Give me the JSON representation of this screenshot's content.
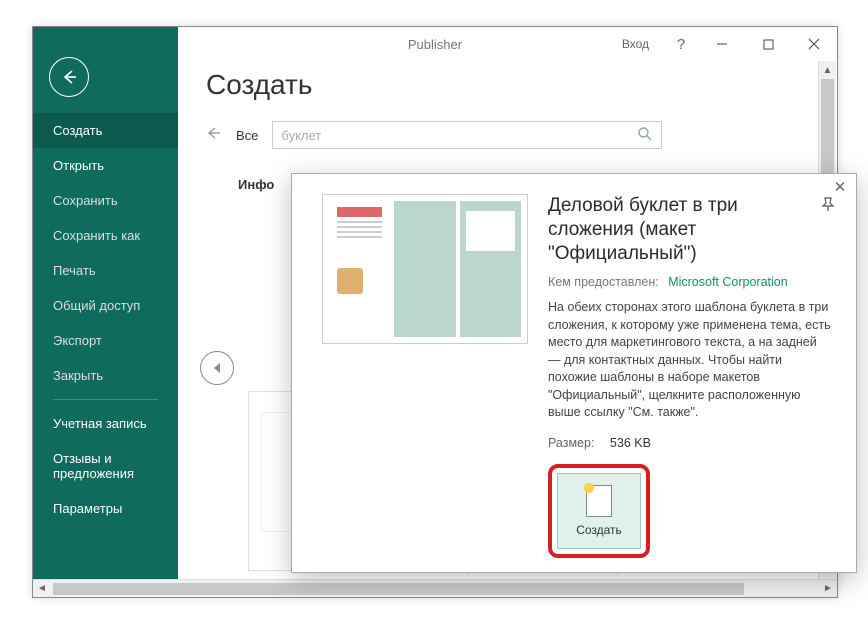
{
  "window": {
    "title": "Publisher",
    "signin": "Вход",
    "help": "?"
  },
  "sidebar": {
    "items": [
      {
        "label": "Создать",
        "active": true
      },
      {
        "label": "Открыть",
        "strong": true
      },
      {
        "label": "Сохранить"
      },
      {
        "label": "Сохранить как"
      },
      {
        "label": "Печать"
      },
      {
        "label": "Общий доступ"
      },
      {
        "label": "Экспорт"
      },
      {
        "label": "Закрыть"
      }
    ],
    "footer": [
      {
        "label": "Учетная запись"
      },
      {
        "label": "Отзывы и предложения"
      },
      {
        "label": "Параметры"
      }
    ]
  },
  "main": {
    "heading": "Создать",
    "all": "Все",
    "search_value": "буклет",
    "category": "Инфо"
  },
  "modal": {
    "title": "Деловой буклет в три сложения (макет \"Официальный\")",
    "provided_label": "Кем предоставлен:",
    "provided_by": "Microsoft Corporation",
    "description": "На обеих сторонах этого шаблона буклета в три сложения, к которому уже применена тема, есть место для маркетингового текста, а на задней — для контактных данных. Чтобы найти похожие шаблоны в наборе макетов \"Официальный\", щелкните расположенную выше ссылку \"См. также\".",
    "size_label": "Размер:",
    "size_value": "536 KB",
    "create_label": "Создать"
  }
}
